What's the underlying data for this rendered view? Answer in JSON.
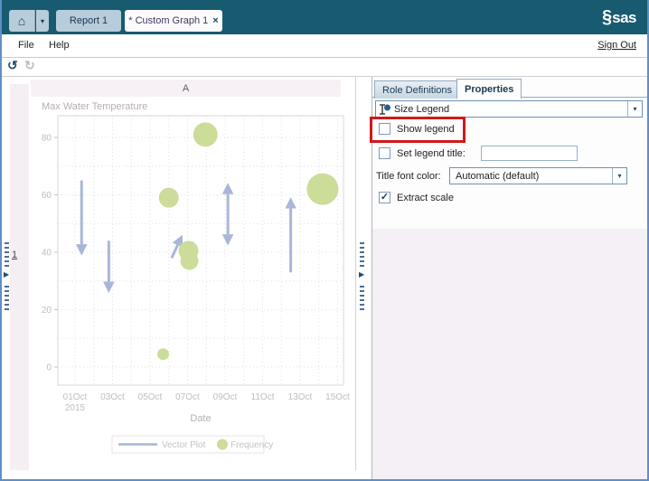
{
  "top_bar": {
    "home_glyph": "⌂",
    "home_drop_glyph": "▾",
    "report_tab": "Report 1",
    "graph_tab": "* Custom Graph 1",
    "close_glyph": "×",
    "logo_glyph": "§",
    "logo_text": "sas",
    "bg_color": "#185a70"
  },
  "menu": {
    "items": [
      "File",
      "Help"
    ],
    "sign_out": "Sign Out"
  },
  "toolbar": {
    "undo_glyph": "↺",
    "redo_glyph": "↻"
  },
  "canvas": {
    "column_header": "A",
    "row_label": "1",
    "expander_glyph": "▶"
  },
  "panel": {
    "tabs": [
      {
        "label": "Role Definitions"
      },
      {
        "label": "Properties"
      }
    ],
    "selector": {
      "label": "Size Legend",
      "arrow": "▾"
    },
    "show_legend": {
      "label": "Show legend",
      "glyph": ""
    },
    "set_legend_title": {
      "label": "Set legend title:",
      "glyph": "",
      "value": ""
    },
    "title_font_color": {
      "label": "Title font color:",
      "value": "Automatic (default)",
      "arrow": "▾"
    },
    "extract_scale": {
      "label": "Extract scale",
      "glyph": "✓"
    },
    "highlight_color": "#d01818"
  },
  "chart_data": {
    "type": "vector-bubble",
    "title": "Max Water Temperature",
    "xlabel": "Date",
    "x_axis": {
      "tick_days": [
        1,
        3,
        5,
        7,
        9,
        11,
        13,
        15
      ],
      "tick_labels": [
        "01Oct",
        "03Oct",
        "05Oct",
        "07Oct",
        "09Oct",
        "11Oct",
        "13Oct",
        "15Oct"
      ],
      "year_label": "2015",
      "grid_days": [
        1,
        2,
        3,
        4,
        5,
        6,
        7,
        8,
        9,
        10,
        11,
        12,
        13,
        14,
        15
      ]
    },
    "y_axis": {
      "ticks": [
        0,
        20,
        40,
        60,
        80
      ],
      "grid_step": 10,
      "range": [
        -6,
        87
      ]
    },
    "grid": true,
    "legend_position": "bottom",
    "series": [
      {
        "name": "Vector Plot",
        "type": "vector",
        "color": "#a9b6da",
        "points": [
          {
            "day": 1.35,
            "from": 65,
            "to": 40,
            "heads": "end"
          },
          {
            "day": 2.8,
            "from": 44,
            "to": 27,
            "heads": "end"
          },
          {
            "day_from": 6.15,
            "value_from": 38,
            "day_to": 6.65,
            "value_to": 45,
            "heads": "end"
          },
          {
            "day": 9.15,
            "from": 43.5,
            "to": 63,
            "heads": "both"
          },
          {
            "day": 12.5,
            "from": 33,
            "to": 58,
            "heads": "end"
          }
        ]
      },
      {
        "name": "Frequency",
        "type": "bubble",
        "color": "#ccdc99",
        "points": [
          {
            "day": 6.0,
            "value": 59,
            "r": 11
          },
          {
            "day": 7.05,
            "value": 40.5,
            "r": 11
          },
          {
            "day": 7.1,
            "value": 37,
            "r": 10
          },
          {
            "day": 7.95,
            "value": 81,
            "r": 13.5
          },
          {
            "day": 14.2,
            "value": 62,
            "r": 17.5
          },
          {
            "day": 5.7,
            "value": 4.5,
            "r": 6.5
          }
        ]
      }
    ]
  }
}
